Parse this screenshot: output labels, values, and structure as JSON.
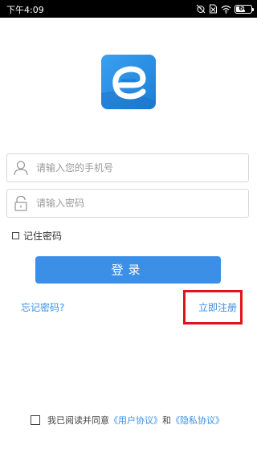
{
  "status_bar": {
    "time": "下午4:09",
    "battery": "60",
    "battery_level": 0.6,
    "icons": [
      "alarm-off-icon",
      "sim-off-icon",
      "wifi-icon",
      "battery-icon"
    ]
  },
  "app": {
    "logo_icon": "e-logo-icon",
    "brand_color": "#2b8ae3"
  },
  "login_form": {
    "phone_placeholder": "请输入您的手机号",
    "phone_value": "",
    "password_placeholder": "请输入密码",
    "password_value": "",
    "remember_label": "记住密码",
    "remember_checked": false,
    "login_label": "登录",
    "forgot_label": "忘记密码?",
    "register_label": "立即注册"
  },
  "agreement": {
    "checked": false,
    "prefix": "我已阅读并同意",
    "user_agreement": "《用户协议》",
    "conjunction": "和",
    "privacy_policy": "《隐私协议》"
  },
  "colors": {
    "accent": "#3b8fe6",
    "highlight": "#e0141a"
  }
}
